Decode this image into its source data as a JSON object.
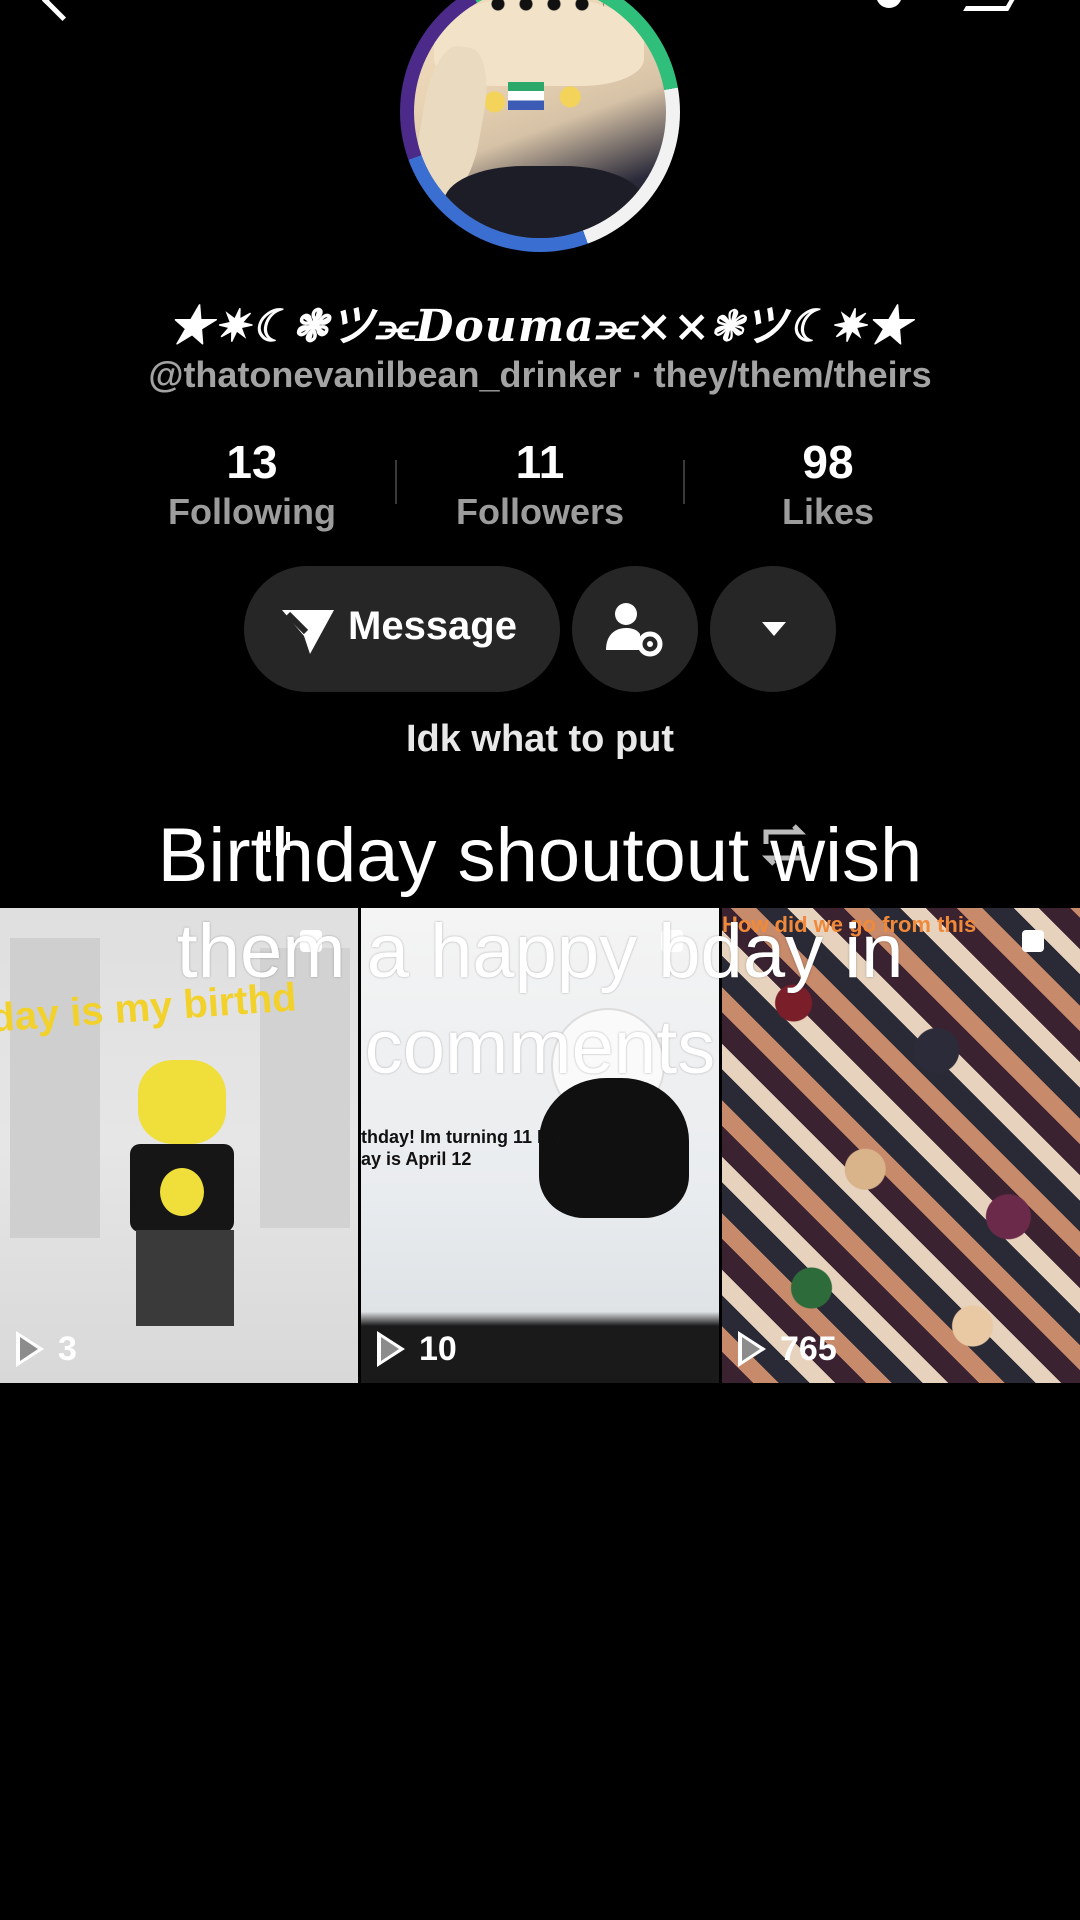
{
  "profile": {
    "display_name": "★✷☾❃ツ⫘Douma⫘××❃ツ☾✷★",
    "handle": "@thatonevanilbean_drinker",
    "pronouns": "· they/them/theirs",
    "bio": "Idk what to put"
  },
  "stats": [
    {
      "value": "13",
      "label": "Following"
    },
    {
      "value": "11",
      "label": "Followers"
    },
    {
      "value": "98",
      "label": "Likes"
    }
  ],
  "actions": {
    "message_label": "Message",
    "friend_icon": "person-gear-icon",
    "more_icon": "caret-down-icon"
  },
  "overlay": {
    "text": "Birthday shoutout wish them a happy bday in comments"
  },
  "videos": [
    {
      "views": "3",
      "caption": "day is my birthd"
    },
    {
      "views": "10",
      "caption": "thday! Im turning 11 My\nay is April 12"
    },
    {
      "views": "765",
      "caption": "How did we go from this"
    }
  ],
  "colors": {
    "background": "#000000",
    "muted_text": "#a3a3a3",
    "button_bg": "#262626"
  }
}
